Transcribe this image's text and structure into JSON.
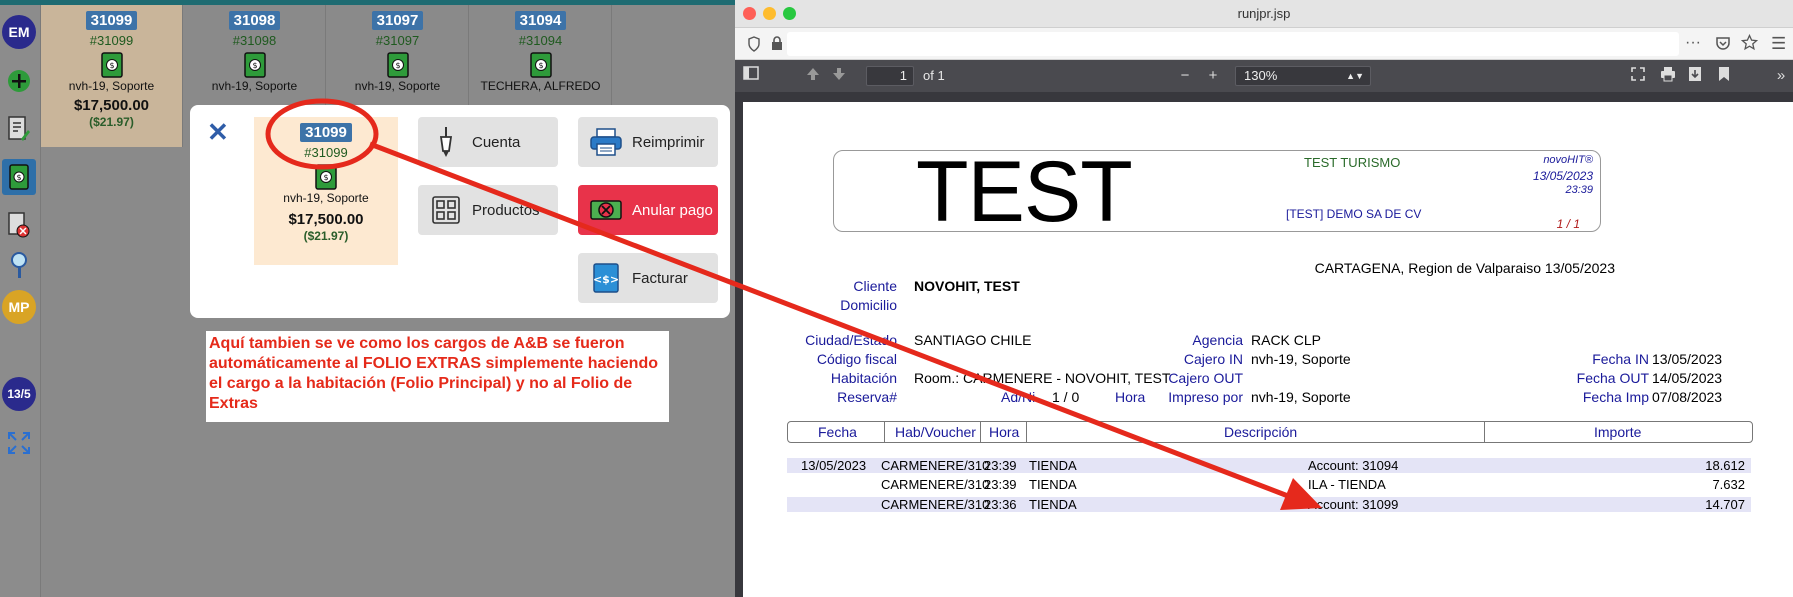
{
  "sidebar": {
    "avatar_top": "EM",
    "avatar_mp": "MP",
    "date_badge": "13/5"
  },
  "tiles": [
    {
      "num": "31099",
      "sub": "#31099",
      "name": "nvh-19, Soporte",
      "amount": "$17,500.00",
      "neg": "($21.97)"
    },
    {
      "num": "31098",
      "sub": "#31098",
      "name": "nvh-19, Soporte"
    },
    {
      "num": "31097",
      "sub": "#31097",
      "name": "nvh-19, Soporte"
    },
    {
      "num": "31094",
      "sub": "#31094",
      "name": "TECHERA, ALFREDO"
    }
  ],
  "modal": {
    "close": "✕",
    "tile": {
      "num": "31099",
      "sub": "#31099",
      "name": "nvh-19, Soporte",
      "amount": "$17,500.00",
      "neg": "($21.97)"
    },
    "buttons": {
      "cuenta": "Cuenta",
      "reimprimir": "Reimprimir",
      "productos": "Productos",
      "anular": "Anular pago",
      "facturar": "Facturar"
    }
  },
  "note": "Aquí tambien se ve como los cargos de A&B se fueron automáticamente al FOLIO EXTRAS simplemente haciendo el cargo a la habitación (Folio Principal) y no al Folio de Extras",
  "browser": {
    "title": "runjpr.jsp",
    "page_current": "1",
    "page_total": "of 1",
    "zoom": "130%"
  },
  "report": {
    "logo": "TEST",
    "company": "TEST TURISMO",
    "company_sub": "[TEST] DEMO  SA DE CV",
    "brand": "novoHIT®",
    "date": "13/05/2023",
    "time": "23:39",
    "page": "1 / 1",
    "location": "CARTAGENA, Region de Valparaiso  13/05/2023",
    "labels": {
      "cliente": "Cliente",
      "domicilio": "Domicilio",
      "ciudad": "Ciudad/Estado",
      "codigo": "Código fiscal",
      "habitacion": "Habitación",
      "reserva": "Reserva#",
      "adni": "Ad/Ni",
      "hora": "Hora",
      "agencia": "Agencia",
      "cajero_in": "Cajero IN",
      "cajero_out": "Cajero OUT",
      "impreso": "Impreso por",
      "fecha_in": "Fecha IN",
      "fecha_out": "Fecha OUT",
      "fecha_imp": "Fecha Imp"
    },
    "values": {
      "cliente": "NOVOHIT, TEST",
      "ciudad": "SANTIAGO  CHILE",
      "habitacion": "Room.: CARMENERE - NOVOHIT, TEST",
      "adni": "1 / 0",
      "agencia": "RACK CLP",
      "cajero_in": "nvh-19, Soporte",
      "impreso": "nvh-19, Soporte",
      "fecha_in": "13/05/2023",
      "fecha_out": "14/05/2023",
      "fecha_imp": "07/08/2023"
    },
    "table": {
      "headers": [
        "Fecha",
        "Hab/Voucher",
        "Hora",
        "Descripción",
        "Importe"
      ],
      "rows": [
        {
          "fecha": "13/05/2023",
          "hab": "CARMENERE/310",
          "hora": "23:39",
          "tipo": "TIENDA",
          "desc": "Account: 31094",
          "importe": "18.612"
        },
        {
          "fecha": "",
          "hab": "CARMENERE/310",
          "hora": "23:39",
          "tipo": "TIENDA",
          "desc": "ILA - TIENDA",
          "importe": "7.632"
        },
        {
          "fecha": "",
          "hab": "CARMENERE/310",
          "hora": "23:36",
          "tipo": "TIENDA",
          "desc": "Account: 31099",
          "importe": "14.707"
        }
      ]
    }
  },
  "colors": {
    "accent_blue": "#3d73a8",
    "danger_red": "#e8334a",
    "annotation_red": "#e52a1a",
    "tile_highlight": "#fde9d1"
  }
}
